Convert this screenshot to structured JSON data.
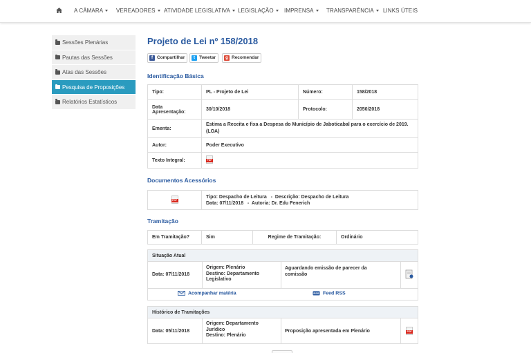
{
  "nav": {
    "home_icon": "home-icon",
    "items": [
      "A CÂMARA",
      "VEREADORES",
      "ATIVIDADE LEGISLATIVA",
      "LEGISLAÇÃO",
      "IMPRENSA",
      "TRANSPARÊNCIA",
      "LINKS ÚTEIS"
    ]
  },
  "sidebar": {
    "items": [
      "Sessões Plenárias",
      "Pautas das Sessões",
      "Atas das Sessões",
      "Pesquisa de Proposições",
      "Relatórios Estatísticos"
    ],
    "active_index": 3
  },
  "title": "Projeto de Lei nº 158/2018",
  "share": {
    "facebook": "Compartilhar",
    "twitter": "Tweetar",
    "google": "Recomendar"
  },
  "identificacao": {
    "heading": "Identificação Básica",
    "tipo_label": "Tipo:",
    "tipo_value": "PL - Projeto de Lei",
    "numero_label": "Número:",
    "numero_value": "158/2018",
    "data_label_1": "Data",
    "data_label_2": "Apresentação:",
    "data_value": "30/10/2018",
    "protocolo_label": "Protocolo:",
    "protocolo_value": "2050/2018",
    "ementa_label": "Ementa:",
    "ementa_value": "Estima a Receita e fixa a Despesa do Município de Jaboticabal para o exercício de 2019. (LOA)",
    "autor_label": "Autor:",
    "autor_value": "Poder Executivo",
    "texto_label": "Texto Integral:"
  },
  "documentos": {
    "heading": "Documentos Acessórios",
    "line1": "Tipo: Despacho de Leitura   -  Descrição: Despacho de Leitura",
    "line2": "Data: 07/11/2018   -  Autoria: Dr. Edu Fenerich"
  },
  "tramitacao": {
    "heading": "Tramitação",
    "em_label": "Em Tramitação?",
    "em_value": "Sim",
    "regime_label": "Regime de Tramitação:",
    "regime_value": "Ordinário",
    "situacao_head": "Situação Atual",
    "sit_data": "Data: 07/11/2018",
    "sit_origem": "Origem: Plenário",
    "sit_destino_1": "Destino: Departamento",
    "sit_destino_2": "Legislativo",
    "sit_status_1": "Aguardando emissão de parecer da",
    "sit_status_2": "comissão",
    "acompanhar": "Acompanhar matéria",
    "feed": "Feed RSS",
    "historico_head": "Histórico de Tramitações",
    "hist_data": "Data: 05/11/2018",
    "hist_origem_1": "Origem: Departamento",
    "hist_origem_2": "Jurídico",
    "hist_destino": "Destino: Plenário",
    "hist_status": "Proposição apresentada em Plenário"
  }
}
